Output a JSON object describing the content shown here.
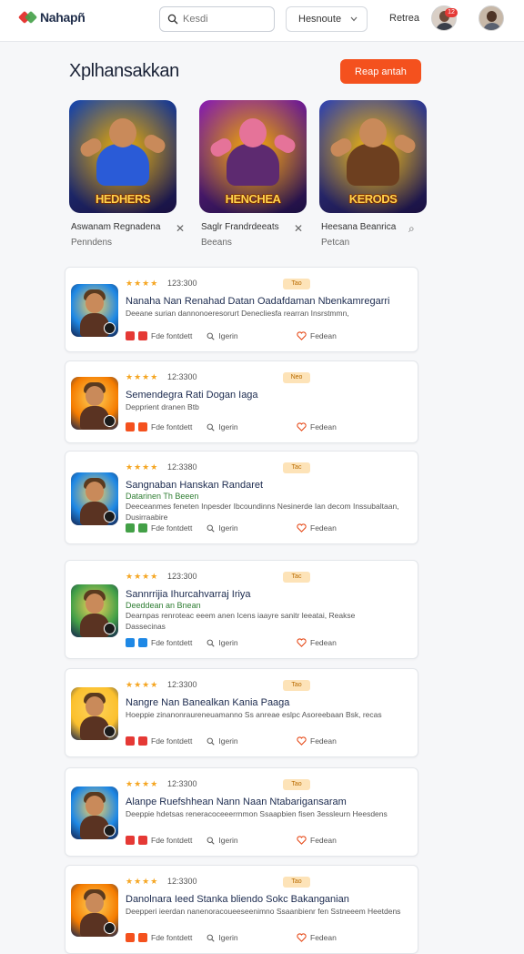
{
  "header": {
    "brand": "Nahapñ",
    "search_placeholder": "Kesdi",
    "dropdown_value": "Hesnoute",
    "nav_link": "Retrea",
    "notification_count": "12"
  },
  "page": {
    "title": "Xplhansakkan",
    "primary_button": "Reap antah"
  },
  "featured": [
    {
      "banner": "HEDHERS",
      "caption": "Aswanam Regnadena",
      "caption2": "Penndens",
      "colors": {
        "bg1": "#1e4aa8",
        "bg2": "#f6b400",
        "skin": "#c98a5a",
        "body": "#2a5bd7"
      }
    },
    {
      "banner": "HENCHEA",
      "caption": "Saglr Frandrdeeats",
      "caption2": "Beeans",
      "colors": {
        "bg1": "#8e24aa",
        "bg2": "#ffb300",
        "skin": "#e57399",
        "body": "#5d2a70"
      }
    },
    {
      "banner": "KERODS",
      "caption": "Heesana Beanrica",
      "caption2": "Petcan",
      "colors": {
        "bg1": "#3949ab",
        "bg2": "#ffc107",
        "skin": "#c98a5a",
        "body": "#6d3f1f"
      }
    }
  ],
  "items": [
    {
      "rating": "123:300",
      "tag": "Tao",
      "title": "Nanaha Nan Renahad Datan Oadafdaman Nbenkamregarri",
      "subtitle": "",
      "desc": [
        "Deeane surian dannonoeresorurt Denecliesfa rearran Insrstmmn,"
      ],
      "action_label": "Fde fontdett",
      "search_label": "Igerin",
      "fav_label": "Fedean",
      "color": "#1e88e5",
      "icons": [
        "#e53935",
        "#e53935"
      ]
    },
    {
      "rating": "12:3300",
      "tag": "Neo",
      "title": "Semendegra Rati Dogan Iaga",
      "subtitle": "",
      "desc": [
        "Depprient dranen Btb"
      ],
      "action_label": "Fde fontdett",
      "search_label": "Igerin",
      "fav_label": "Fedean",
      "color": "#f57c00",
      "icons": [
        "#f4511e",
        "#f4511e"
      ]
    },
    {
      "rating": "12:3380",
      "tag": "Tac",
      "title": "Sangnaban Hanskan Randaret",
      "subtitle": "Datarinen Th Beeen",
      "desc": [
        "Deeceanmes feneten Inpesder Ibcoundinns Nesinerde Ian decom Inssubaltaan,",
        "Dusirraabire"
      ],
      "action_label": "Fde fontdett",
      "search_label": "Igerin",
      "fav_label": "Fedean",
      "color": "#1e88e5",
      "icons": [
        "#43a047",
        "#43a047"
      ]
    },
    {
      "rating": "123:300",
      "tag": "Tac",
      "title": "Sannrrijia Ihurcahvarraj Iriya",
      "subtitle": "Deeddean an Bnean",
      "desc": [
        "Dearnpas renroteac eeem anen Icens iaayre sanitr leeatai, Reakse",
        "Dassecinas"
      ],
      "action_label": "Fde fontdett",
      "search_label": "Igerin",
      "fav_label": "Fedean",
      "color": "#43a047",
      "icons": [
        "#1e88e5",
        "#1e88e5"
      ]
    },
    {
      "rating": "12:3300",
      "tag": "Tao",
      "title": "Nangre Nan Banealkan Kania Paaga",
      "subtitle": "",
      "desc": [
        "Hoeppie zinanonraureneuamanno Ss anreae eslpc Asoreebaan Bsk, recas"
      ],
      "action_label": "Fde fontdett",
      "search_label": "Igerin",
      "fav_label": "Fedean",
      "color": "#fbc02d",
      "icons": [
        "#e53935",
        "#e53935"
      ]
    },
    {
      "rating": "12:3300",
      "tag": "Tao",
      "title": "Alanpe Ruefshhean Nann Naan Ntabarigansaram",
      "subtitle": "",
      "desc": [
        "Deeppie hdetsas reneracoceeerrnmon Ssaapbien fisen 3essleurn Heesdens"
      ],
      "action_label": "Fde fontdett",
      "search_label": "Igerin",
      "fav_label": "Fedean",
      "color": "#1e88e5",
      "icons": [
        "#e53935",
        "#e53935"
      ]
    },
    {
      "rating": "12:3300",
      "tag": "Tao",
      "title": "Danolnara Ieed Stanka bliendo Sokc Bakanganian",
      "subtitle": "",
      "desc": [
        "Deepperi ieerdan nanenoracoueeseenimno Ssaanbienr fen Sstneeem Heetdens"
      ],
      "action_label": "Fde fontdett",
      "search_label": "Igerin",
      "fav_label": "Fedean",
      "color": "#f57c00",
      "icons": [
        "#f4511e",
        "#f4511e"
      ]
    }
  ]
}
